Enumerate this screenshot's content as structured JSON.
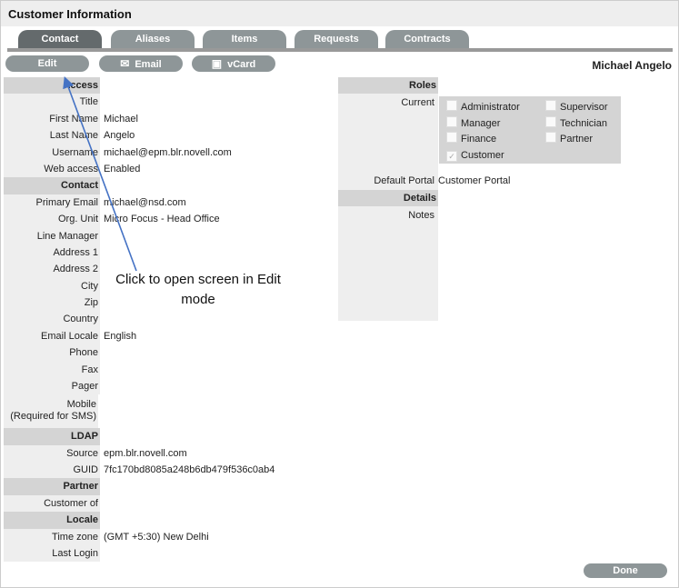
{
  "title": "Customer Information",
  "tabs": [
    {
      "label": "Contact",
      "active": true
    },
    {
      "label": "Aliases"
    },
    {
      "label": "Items"
    },
    {
      "label": "Requests"
    },
    {
      "label": "Contracts"
    }
  ],
  "toolbar": {
    "edit": "Edit",
    "email": "Email",
    "vcard": "vCard"
  },
  "user_name": "Michael Angelo",
  "left_rows": [
    {
      "label": "Access",
      "header": true
    },
    {
      "label": "Title",
      "value": ""
    },
    {
      "label": "First Name",
      "value": "Michael"
    },
    {
      "label": "Last Name",
      "value": "Angelo"
    },
    {
      "label": "Username",
      "value": "michael@epm.blr.novell.com"
    },
    {
      "label": "Web access",
      "value": "Enabled"
    },
    {
      "label": "Contact",
      "header": true
    },
    {
      "label": "Primary Email",
      "value": "michael@nsd.com"
    },
    {
      "label": "Org. Unit",
      "value": "Micro Focus - Head Office"
    },
    {
      "label": "Line Manager",
      "value": ""
    },
    {
      "label": "Address 1",
      "value": ""
    },
    {
      "label": "Address 2",
      "value": ""
    },
    {
      "label": "City",
      "value": ""
    },
    {
      "label": "Zip",
      "value": ""
    },
    {
      "label": "Country",
      "value": ""
    },
    {
      "label": "Email Locale",
      "value": "English"
    },
    {
      "label": "Phone",
      "value": ""
    },
    {
      "label": "Fax",
      "value": ""
    },
    {
      "label": "Pager",
      "value": ""
    },
    {
      "label": "Mobile",
      "sublabel": "(Required for SMS)",
      "value": "",
      "double": true
    },
    {
      "label": "LDAP",
      "header": true
    },
    {
      "label": "Source",
      "value": "epm.blr.novell.com"
    },
    {
      "label": "GUID",
      "value": "7fc170bd8085a248b6db479f536c0ab4"
    },
    {
      "label": "Partner",
      "header": true
    },
    {
      "label": "Customer of",
      "value": ""
    },
    {
      "label": "Locale",
      "header": true
    },
    {
      "label": "Time zone",
      "value": "(GMT +5:30) New Delhi"
    },
    {
      "label": "Last Login",
      "value": ""
    }
  ],
  "right": {
    "roles_header": "Roles",
    "current_label": "Current",
    "roles": [
      {
        "label": "Administrator",
        "checked": false
      },
      {
        "label": "Supervisor",
        "checked": false
      },
      {
        "label": "Manager",
        "checked": false
      },
      {
        "label": "Technician",
        "checked": false
      },
      {
        "label": "Finance",
        "checked": false
      },
      {
        "label": "Partner",
        "checked": false
      },
      {
        "label": "Customer",
        "checked": true
      }
    ],
    "default_portal_label": "Default Portal",
    "default_portal_value": "Customer Portal",
    "details_header": "Details",
    "notes_label": "Notes"
  },
  "annotation": "Click to open screen in Edit mode",
  "done": "Done",
  "colors": {
    "button": "#8e9698",
    "active_tab": "#646a6c",
    "arrow": "#4472c4"
  }
}
